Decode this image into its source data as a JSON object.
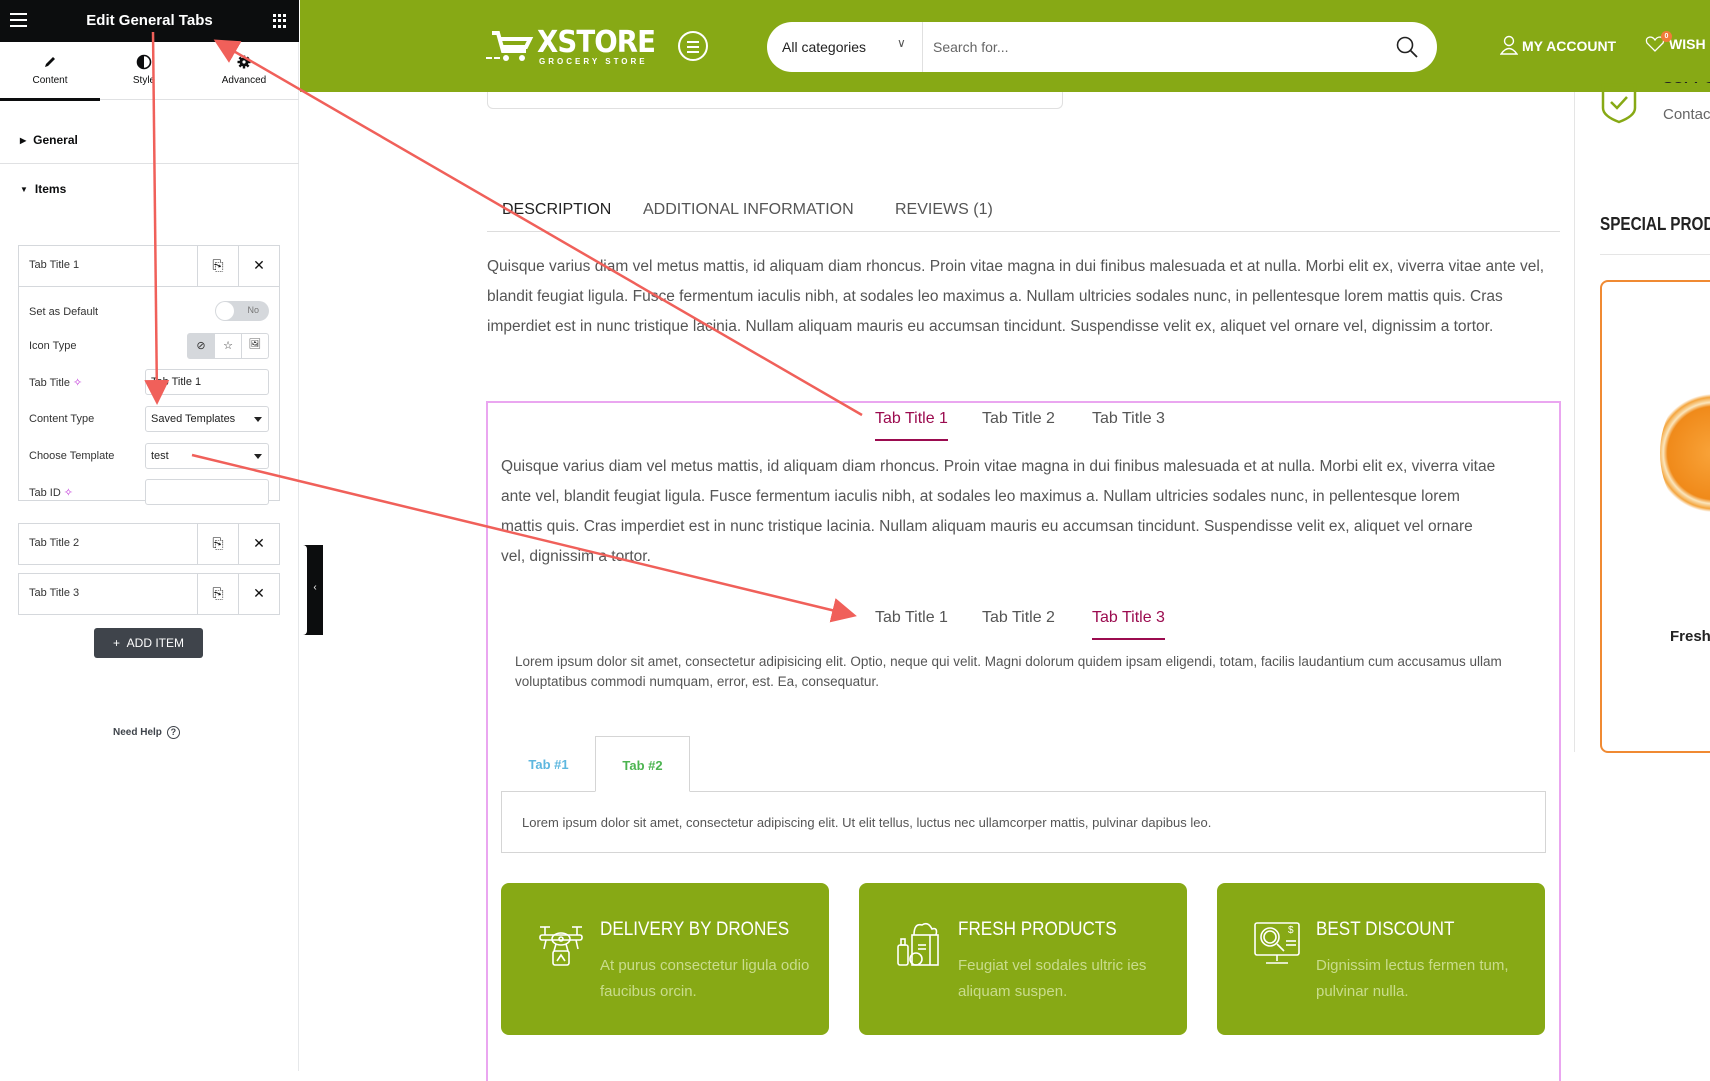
{
  "panel": {
    "title": "Edit General Tabs",
    "tabs": [
      {
        "label": "Content",
        "icon": "pencil-icon",
        "active": true
      },
      {
        "label": "Style",
        "icon": "half-circle-icon",
        "active": false
      },
      {
        "label": "Advanced",
        "icon": "gear-icon",
        "active": false
      }
    ],
    "sections": {
      "general": "General",
      "items": "Items"
    },
    "items": [
      {
        "title": "Tab Title 1",
        "expanded": true
      },
      {
        "title": "Tab Title 2",
        "expanded": false
      },
      {
        "title": "Tab Title 3",
        "expanded": false
      }
    ],
    "fields": {
      "set_default_label": "Set as Default",
      "set_default_value": "No",
      "icon_type_label": "Icon Type",
      "tab_title_label": "Tab Title",
      "tab_title_value": "Tab Title 1",
      "content_type_label": "Content Type",
      "content_type_value": "Saved Templates",
      "choose_template_label": "Choose Template",
      "choose_template_value": "test",
      "tab_id_label": "Tab ID",
      "tab_id_value": ""
    },
    "add_item": "ADD ITEM",
    "need_help": "Need Help"
  },
  "header": {
    "logo_main": "XSTORE",
    "logo_sub": "GROCERY STORE",
    "category_select": "All categories",
    "search_placeholder": "Search for...",
    "my_account": "MY ACCOUNT",
    "wishlist": "WISH",
    "wishlist_count": "0",
    "brand_color": "#87a915"
  },
  "product_tabs": {
    "tabs": [
      "DESCRIPTION",
      "ADDITIONAL INFORMATION",
      "REVIEWS (1)"
    ],
    "active": 0,
    "description": "Quisque varius diam vel metus mattis, id aliquam diam rhoncus. Proin vitae magna in dui finibus malesuada et at nulla. Morbi elit ex, viverra vitae ante vel, blandit feugiat ligula. Fusce fermentum iaculis nibh, at sodales leo maximus a. Nullam ultricies sodales nunc, in pellentesque lorem mattis quis. Cras imperdiet est in nunc tristique lacinia. Nullam aliquam mauris eu accumsan tincidunt. Suspendisse velit ex, aliquet vel ornare vel, dignissim a tortor."
  },
  "general_tabs": {
    "tabs": [
      "Tab Title 1",
      "Tab Title 2",
      "Tab Title 3"
    ],
    "active": 0,
    "content": "Quisque varius diam vel metus mattis, id aliquam diam rhoncus. Proin vitae magna in dui finibus malesuada et at nulla. Morbi elit ex, viverra vitae ante vel, blandit feugiat ligula. Fusce fermentum iaculis nibh, at sodales leo maximus a. Nullam ultricies sodales nunc, in pellentesque lorem mattis quis. Cras imperdiet est in nunc tristique lacinia. Nullam aliquam mauris eu accumsan tincidunt. Suspendisse velit ex, aliquet vel ornare vel, dignissim a tortor.",
    "accent_color": "#9b0b4f"
  },
  "nested_tabs": {
    "tabs": [
      "Tab Title 1",
      "Tab Title 2",
      "Tab Title 3"
    ],
    "active": 2,
    "content": "Lorem ipsum dolor sit amet, consectetur adipisicing elit. Optio, neque qui velit. Magni dolorum quidem ipsam eligendi, totam, facilis laudantium cum accusamus ullam voluptatibus commodi numquam, error, est. Ea, consequatur."
  },
  "basic_tabs": {
    "tabs": [
      "Tab #1",
      "Tab #2"
    ],
    "active": 1,
    "content": "Lorem ipsum dolor sit amet, consectetur adipiscing elit. Ut elit tellus, luctus nec ullamcorper mattis, pulvinar dapibus leo."
  },
  "features": [
    {
      "icon": "drone-icon",
      "title": "DELIVERY BY DRONES",
      "text": "At purus consectetur ligula odio faucibus orcin."
    },
    {
      "icon": "grocery-bag-icon",
      "title": "FRESH PRODUCTS",
      "text": "Feugiat vel sodales ultric ies aliquam suspen."
    },
    {
      "icon": "discount-monitor-icon",
      "title": "BEST DISCOUNT",
      "text": "Dignissim lectus fermen tum, pulvinar nulla."
    }
  ],
  "sidebar": {
    "support_title": "SUPPORT",
    "support_text": "Contac",
    "special_heading": "SPECIAL PRODU",
    "product_name": "Fresh O"
  }
}
